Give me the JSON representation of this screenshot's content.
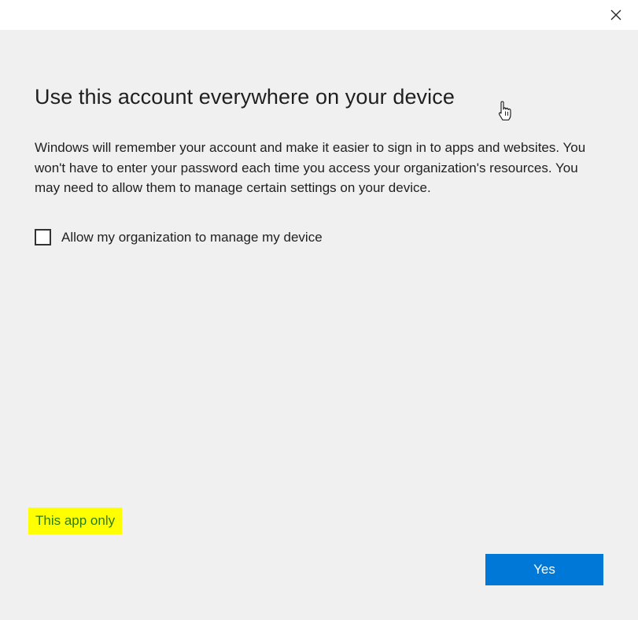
{
  "window": {
    "close_icon": "close-icon"
  },
  "dialog": {
    "title": "Use this account everywhere on your device",
    "description": "Windows will remember your account and make it easier to sign in to apps and websites. You won't have to enter your password each time you access your organization's resources. You may need to allow them to manage certain settings on your device.",
    "checkbox_label": "Allow my organization to manage my device",
    "checkbox_checked": false,
    "app_only_link": "This app only",
    "yes_button": "Yes"
  },
  "colors": {
    "content_background": "#f0f0f0",
    "primary_button": "#0078d7",
    "link_text": "#2e7d0e",
    "highlight": "#ffff00"
  },
  "cursor": "hand-pointer-icon"
}
